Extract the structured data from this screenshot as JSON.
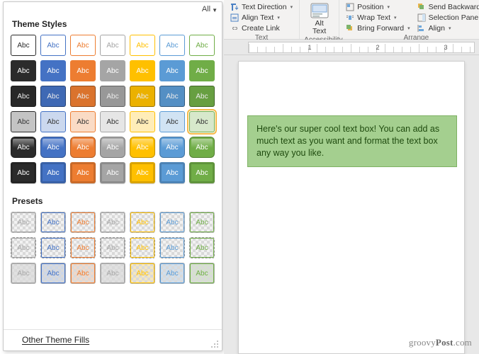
{
  "gallery": {
    "all_label": "All",
    "theme_styles_label": "Theme Styles",
    "presets_label": "Presets",
    "other_fills_label": "Other Theme Fills",
    "sample_text": "Abc",
    "colors": {
      "black": "#2b2b2b",
      "blue": "#4472c4",
      "orange": "#ed7d31",
      "gray": "#a5a5a5",
      "gold": "#ffc000",
      "lblue": "#5b9bd5",
      "green": "#70ad47"
    },
    "row1_outline": [
      "black",
      "blue",
      "orange",
      "gray",
      "gold",
      "lblue",
      "green"
    ],
    "preset_colors": [
      "gray",
      "blue",
      "orange",
      "gray",
      "gold",
      "lblue",
      "green"
    ]
  },
  "ribbon": {
    "text_group": {
      "title": "Text",
      "text_direction": "Text Direction",
      "align_text": "Align Text",
      "create_link": "Create Link"
    },
    "accessibility_group": {
      "title": "Accessibility",
      "alt_text_line1": "Alt",
      "alt_text_line2": "Text"
    },
    "arrange_group": {
      "title": "Arrange",
      "position": "Position",
      "wrap_text": "Wrap Text",
      "bring_forward": "Bring Forward",
      "send_backward": "Send Backward",
      "selection_pane": "Selection Pane",
      "align": "Align"
    }
  },
  "ruler": {
    "ticks": [
      1,
      2,
      3
    ]
  },
  "document": {
    "textbox_content": "Here's our super cool text box! You can add as much text as you want and format the text box any way you like."
  },
  "watermark": {
    "brand1": "groovy",
    "brand2": "Post",
    "suffix": ".com"
  }
}
